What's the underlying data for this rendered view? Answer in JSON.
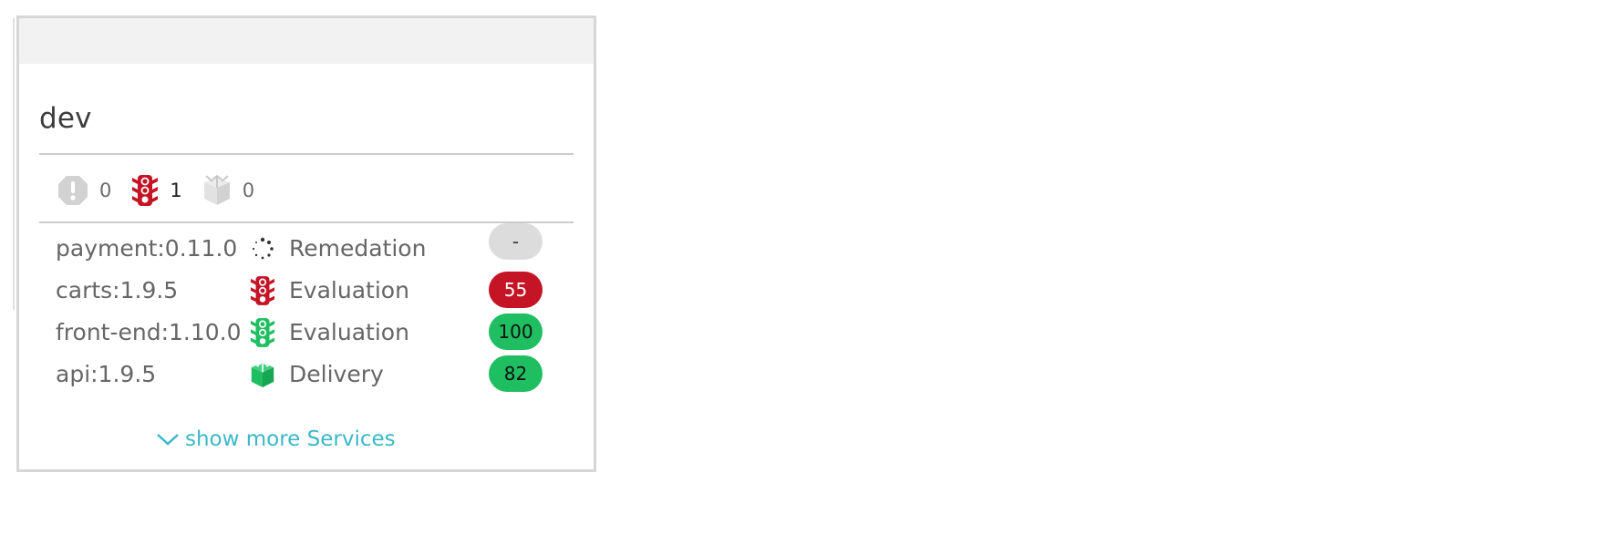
{
  "stage": {
    "title": "dev"
  },
  "summary": {
    "problems": {
      "icon": "problem-icon",
      "count": "0",
      "color": "#d2d2d2"
    },
    "evaluations": {
      "icon": "traffic-light-icon",
      "count": "1",
      "color": "#c41425"
    },
    "deliveries": {
      "icon": "delivery-box-icon",
      "count": "0",
      "color": "#d2d2d2"
    }
  },
  "services": [
    {
      "name": "payment:0.11.0",
      "icon": "loading-spinner-icon",
      "stage": "Remedation",
      "score": "-",
      "status": "neutral"
    },
    {
      "name": "carts:1.9.5",
      "icon": "traffic-light-icon",
      "stage": "Evaluation",
      "score": "55",
      "status": "fail"
    },
    {
      "name": "front-end:1.10.0",
      "icon": "traffic-light-icon",
      "stage": "Evaluation",
      "score": "100",
      "status": "pass"
    },
    {
      "name": "api:1.9.5",
      "icon": "delivery-box-icon",
      "stage": "Delivery",
      "score": "82",
      "status": "pass"
    }
  ],
  "colors": {
    "fail": "#c41425",
    "pass": "#1ebe61",
    "neutral": "#dcdcdc",
    "link": "#3bb8c9"
  },
  "show_more": {
    "label": "show more Services",
    "icon": "chevron-down-icon"
  }
}
